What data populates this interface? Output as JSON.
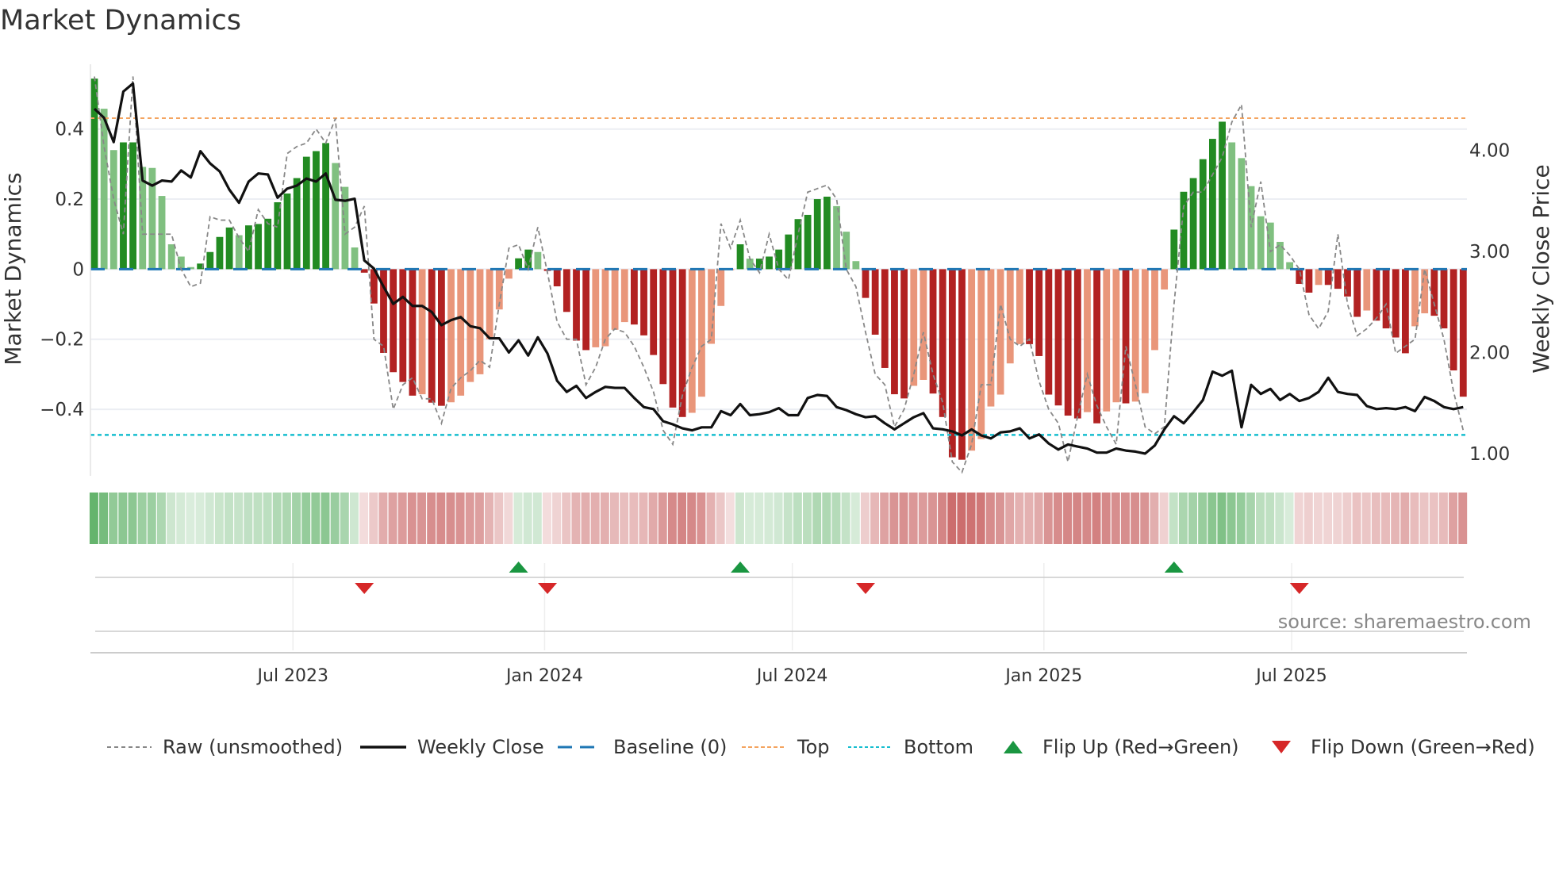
{
  "title": "Market Dynamics",
  "source": "source: sharemaestro.com",
  "legend": {
    "raw": "Raw (unsmoothed)",
    "close": "Weekly Close",
    "baseline": "Baseline (0)",
    "top": "Top",
    "bottom": "Bottom",
    "flip_up": "Flip Up (Red→Green)",
    "flip_down": "Flip Down (Green→Red)"
  },
  "colors": {
    "pos_strong": "#228b22",
    "pos_weak": "#80c080",
    "neg_strong": "#b22222",
    "neg_weak": "#e9967a",
    "close": "#111111",
    "raw": "#888888",
    "baseline": "#1f77b4",
    "top": "#f4a460",
    "bottom": "#17becf",
    "flip_up": "#1a9641",
    "flip_down": "#d62728"
  },
  "chart_data": {
    "type": "bar",
    "title": "Market Dynamics",
    "ylabel": "Market Dynamics",
    "y2label": "Weekly Close Price",
    "ylim": [
      -0.59,
      0.585
    ],
    "y2lim": [
      0.78,
      4.85
    ],
    "yticks": [
      {
        "v": 0.4,
        "label": "0.4"
      },
      {
        "v": 0.2,
        "label": "0.2"
      },
      {
        "v": 0,
        "label": "0"
      },
      {
        "v": -0.2,
        "label": "−0.2"
      },
      {
        "v": -0.4,
        "label": "−0.4"
      }
    ],
    "y2ticks": [
      {
        "v": 4,
        "label": "4.00"
      },
      {
        "v": 3,
        "label": "3.00"
      },
      {
        "v": 2,
        "label": "2.00"
      },
      {
        "v": 1,
        "label": "1.00"
      }
    ],
    "xticks": [
      {
        "v": 20.6,
        "label": "Jul 2023"
      },
      {
        "v": 46.7,
        "label": "Jan 2024"
      },
      {
        "v": 72.4,
        "label": "Jul 2024"
      },
      {
        "v": 98.5,
        "label": "Jan 2025"
      },
      {
        "v": 124.2,
        "label": "Jul 2025"
      }
    ],
    "top_level": 0.431,
    "bottom_level": -0.473,
    "baseline": 0,
    "flip_up": [
      44,
      67,
      112
    ],
    "flip_down": [
      28,
      47,
      80,
      125
    ],
    "momentum": [
      0.544,
      0.458,
      0.34,
      0.362,
      0.362,
      0.292,
      0.289,
      0.209,
      0.071,
      0.036,
      0.006,
      0.016,
      0.049,
      0.092,
      0.119,
      0.097,
      0.125,
      0.129,
      0.144,
      0.191,
      0.216,
      0.26,
      0.321,
      0.337,
      0.36,
      0.303,
      0.235,
      0.062,
      -0.01,
      -0.098,
      -0.239,
      -0.294,
      -0.322,
      -0.361,
      -0.357,
      -0.381,
      -0.39,
      -0.38,
      -0.361,
      -0.322,
      -0.3,
      -0.2,
      -0.115,
      -0.027,
      0.031,
      0.056,
      0.049,
      -0.005,
      -0.049,
      -0.122,
      -0.204,
      -0.231,
      -0.223,
      -0.22,
      -0.173,
      -0.151,
      -0.158,
      -0.189,
      -0.245,
      -0.328,
      -0.395,
      -0.422,
      -0.41,
      -0.364,
      -0.213,
      -0.105,
      -0.003,
      0.071,
      0.03,
      0.03,
      0.036,
      0.056,
      0.099,
      0.143,
      0.155,
      0.2,
      0.207,
      0.18,
      0.107,
      0.023,
      -0.082,
      -0.187,
      -0.282,
      -0.357,
      -0.369,
      -0.333,
      -0.316,
      -0.355,
      -0.422,
      -0.537,
      -0.544,
      -0.518,
      -0.485,
      -0.392,
      -0.358,
      -0.269,
      -0.214,
      -0.214,
      -0.248,
      -0.358,
      -0.389,
      -0.418,
      -0.426,
      -0.408,
      -0.44,
      -0.406,
      -0.38,
      -0.383,
      -0.378,
      -0.354,
      -0.231,
      -0.058,
      0.113,
      0.221,
      0.26,
      0.314,
      0.372,
      0.421,
      0.362,
      0.317,
      0.237,
      0.151,
      0.133,
      0.078,
      0.02,
      -0.042,
      -0.067,
      -0.045,
      -0.045,
      -0.056,
      -0.078,
      -0.136,
      -0.118,
      -0.147,
      -0.169,
      -0.195,
      -0.24,
      -0.163,
      -0.126,
      -0.133,
      -0.169,
      -0.289,
      -0.364
    ],
    "raw": [
      0.55,
      0.35,
      0.2,
      0.1,
      0.55,
      0.1,
      0.1,
      0.1,
      0.1,
      0.0,
      -0.05,
      -0.04,
      0.15,
      0.14,
      0.14,
      0.09,
      0.05,
      0.17,
      0.13,
      0.12,
      0.33,
      0.35,
      0.36,
      0.4,
      0.36,
      0.43,
      0.1,
      0.12,
      0.18,
      -0.2,
      -0.22,
      -0.4,
      -0.33,
      -0.31,
      -0.37,
      -0.37,
      -0.44,
      -0.34,
      -0.31,
      -0.29,
      -0.26,
      -0.28,
      -0.1,
      0.06,
      0.07,
      0.0,
      0.12,
      -0.01,
      -0.15,
      -0.2,
      -0.2,
      -0.33,
      -0.28,
      -0.2,
      -0.17,
      -0.18,
      -0.22,
      -0.28,
      -0.35,
      -0.46,
      -0.5,
      -0.36,
      -0.28,
      -0.22,
      -0.2,
      0.13,
      0.06,
      0.14,
      0.03,
      -0.01,
      0.1,
      0.0,
      -0.03,
      0.1,
      0.22,
      0.23,
      0.24,
      0.2,
      0.0,
      -0.05,
      -0.18,
      -0.3,
      -0.33,
      -0.45,
      -0.4,
      -0.3,
      -0.18,
      -0.3,
      -0.38,
      -0.55,
      -0.58,
      -0.5,
      -0.33,
      -0.33,
      -0.1,
      -0.2,
      -0.22,
      -0.2,
      -0.32,
      -0.4,
      -0.44,
      -0.55,
      -0.42,
      -0.3,
      -0.39,
      -0.45,
      -0.5,
      -0.22,
      -0.33,
      -0.45,
      -0.47,
      -0.45,
      -0.1,
      0.18,
      0.22,
      0.22,
      0.27,
      0.32,
      0.42,
      0.47,
      0.12,
      0.25,
      0.05,
      0.07,
      0.04,
      0.0,
      -0.13,
      -0.17,
      -0.12,
      0.1,
      -0.1,
      -0.19,
      -0.17,
      -0.14,
      -0.1,
      -0.24,
      -0.22,
      -0.2,
      0.0,
      -0.1,
      -0.2,
      -0.35,
      -0.46
    ],
    "close": [
      4.41,
      4.32,
      4.08,
      4.58,
      4.66,
      3.7,
      3.65,
      3.7,
      3.69,
      3.8,
      3.73,
      3.99,
      3.87,
      3.79,
      3.61,
      3.48,
      3.69,
      3.77,
      3.76,
      3.53,
      3.62,
      3.65,
      3.72,
      3.69,
      3.77,
      3.51,
      3.5,
      3.52,
      2.91,
      2.83,
      2.65,
      2.48,
      2.55,
      2.46,
      2.46,
      2.4,
      2.27,
      2.32,
      2.35,
      2.26,
      2.24,
      2.14,
      2.14,
      2.0,
      2.12,
      1.97,
      2.15,
      1.99,
      1.72,
      1.61,
      1.67,
      1.55,
      1.61,
      1.66,
      1.65,
      1.65,
      1.55,
      1.46,
      1.44,
      1.32,
      1.29,
      1.25,
      1.23,
      1.26,
      1.26,
      1.42,
      1.38,
      1.49,
      1.38,
      1.39,
      1.41,
      1.45,
      1.38,
      1.38,
      1.55,
      1.58,
      1.57,
      1.46,
      1.43,
      1.39,
      1.36,
      1.37,
      1.3,
      1.24,
      1.3,
      1.36,
      1.4,
      1.25,
      1.24,
      1.22,
      1.18,
      1.24,
      1.18,
      1.15,
      1.21,
      1.22,
      1.25,
      1.15,
      1.19,
      1.1,
      1.04,
      1.09,
      1.07,
      1.05,
      1.01,
      1.01,
      1.05,
      1.03,
      1.02,
      1.0,
      1.08,
      1.24,
      1.37,
      1.3,
      1.41,
      1.53,
      1.81,
      1.77,
      1.82,
      1.26,
      1.68,
      1.59,
      1.64,
      1.53,
      1.59,
      1.52,
      1.55,
      1.61,
      1.75,
      1.61,
      1.59,
      1.58,
      1.47,
      1.44,
      1.45,
      1.44,
      1.46,
      1.42,
      1.56,
      1.52,
      1.46,
      1.44,
      1.46
    ]
  }
}
